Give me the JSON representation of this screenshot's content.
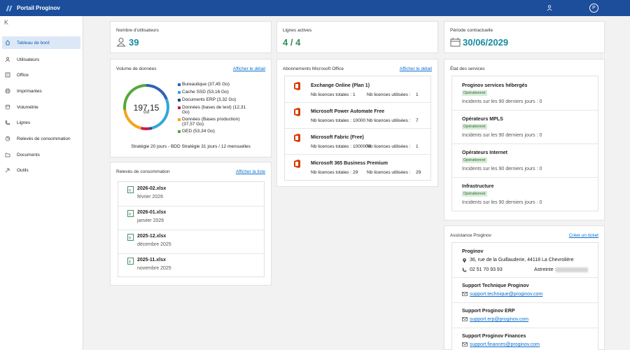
{
  "app": {
    "title": "Portail Proginov",
    "avatar_initial": "P"
  },
  "sidebar": {
    "collapse_icon": "K",
    "items": [
      {
        "label": "Tableau de bord",
        "icon": "home-icon"
      },
      {
        "label": "Utilisateurs",
        "icon": "user-icon"
      },
      {
        "label": "Office",
        "icon": "document-icon"
      },
      {
        "label": "Imprimantes",
        "icon": "printer-icon"
      },
      {
        "label": "Volumétrie",
        "icon": "database-icon"
      },
      {
        "label": "Lignes",
        "icon": "phone-icon"
      },
      {
        "label": "Relevés de consommation",
        "icon": "chart-icon"
      },
      {
        "label": "Documents",
        "icon": "folder-icon"
      },
      {
        "label": "Outils",
        "icon": "tools-icon"
      }
    ]
  },
  "stats": {
    "users": {
      "label": "Nombre d'utilisateurs",
      "value": "39"
    },
    "lines": {
      "label": "Lignes actives",
      "value": "4 / 4"
    },
    "period": {
      "label": "Période contractuelle",
      "value": "30/06/2029"
    }
  },
  "volume": {
    "title": "Volume de données",
    "link": "Afficher le détail",
    "total": "197,15",
    "unit": "Go",
    "strategy": "Stratégie 20 jours - BDD Stratégie 31 jours / 12 mensuelles",
    "legend": [
      {
        "label": "Bureautique (37,45 Go)",
        "color": "#2e62b8",
        "value": 37.45
      },
      {
        "label": "Cache SSD (53,16 Go)",
        "color": "#34a6d9",
        "value": 53.16
      },
      {
        "label": "Documents ERP (3,32 Go)",
        "color": "#2c3e8f",
        "value": 3.32
      },
      {
        "label": "Données (bases de test) (12,31 Go)",
        "color": "#c51e4b",
        "value": 12.31
      },
      {
        "label": "Données (Bases production) (37,57 Go)",
        "color": "#f3a51d",
        "value": 37.57
      },
      {
        "label": "GED (53,34 Go)",
        "color": "#57a93a",
        "value": 53.34
      }
    ]
  },
  "releves": {
    "title": "Relevés de consommation",
    "link": "Afficher la liste",
    "items": [
      {
        "name": "2026-02.xlsx",
        "date": "février 2026"
      },
      {
        "name": "2026-01.xlsx",
        "date": "janvier 2026"
      },
      {
        "name": "2025-12.xlsx",
        "date": "décembre 2025"
      },
      {
        "name": "2025-11.xlsx",
        "date": "novembre 2025"
      }
    ]
  },
  "office": {
    "title": "Abonnements Microsoft Office",
    "link": "Afficher le détail",
    "total_label": "Nb licences totales :",
    "used_label": "Nb licences utilisées :",
    "items": [
      {
        "name": "Exchange Online (Plan 1)",
        "total": "1",
        "used": "1"
      },
      {
        "name": "Microsoft Power Automate Free",
        "total": "10000",
        "used": "7"
      },
      {
        "name": "Microsoft Fabric (Free)",
        "total": "1000000",
        "used": "1"
      },
      {
        "name": "Microsoft 365 Business Premium",
        "total": "29",
        "used": "29"
      }
    ]
  },
  "services": {
    "title": "État des services",
    "incident_label": "Incidents sur les 90 derniers jours :",
    "items": [
      {
        "name": "Proginov services hébergés",
        "status": "Opérationnel",
        "incidents": "0"
      },
      {
        "name": "Opérateurs MPLS",
        "status": "Opérationnel",
        "incidents": "0"
      },
      {
        "name": "Opérateurs Internet",
        "status": "Opérationnel",
        "incidents": "0"
      },
      {
        "name": "Infrastructure",
        "status": "Opérationnel",
        "incidents": "0"
      }
    ]
  },
  "assistance": {
    "title": "Assistance Proginov",
    "link": "Créer un ticket",
    "company": "Proginov",
    "address": "36, rue de la Guillauderie, 44118 La Chevrolière",
    "phone": "02 51 70 93 93",
    "astreinte_label": "Astreinte :",
    "support": [
      {
        "name": "Support Technique Proginov",
        "email": "support.technique@proginov.com"
      },
      {
        "name": "Support Proginov ERP",
        "email": "support.erp@proginov.com"
      },
      {
        "name": "Support Proginov Finances",
        "email": "support.finances@proginov.com"
      }
    ]
  }
}
